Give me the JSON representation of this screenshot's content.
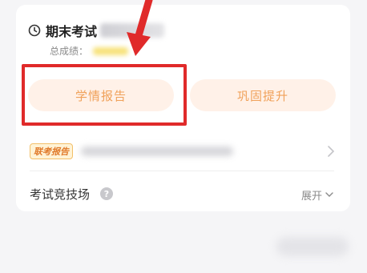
{
  "exam": {
    "title": "期末考试",
    "score_label": "总成绩："
  },
  "actions": {
    "study_report": "学情报告",
    "boost": "巩固提升"
  },
  "joint_exam": {
    "badge": "联考报告"
  },
  "arena": {
    "label": "考试竞技场",
    "help_glyph": "?",
    "expand_label": "展开"
  },
  "icons": {
    "clock": "clock-icon",
    "help": "question-circle-icon",
    "chevron_right": "chevron-right-icon",
    "chevron_down": "chevron-down-icon",
    "arrow": "arrow-down-icon"
  },
  "colors": {
    "pill_bg": "#fff1e8",
    "pill_text": "#f0a15a",
    "highlight": "#e02a2a",
    "badge_text": "#e07a2a"
  }
}
